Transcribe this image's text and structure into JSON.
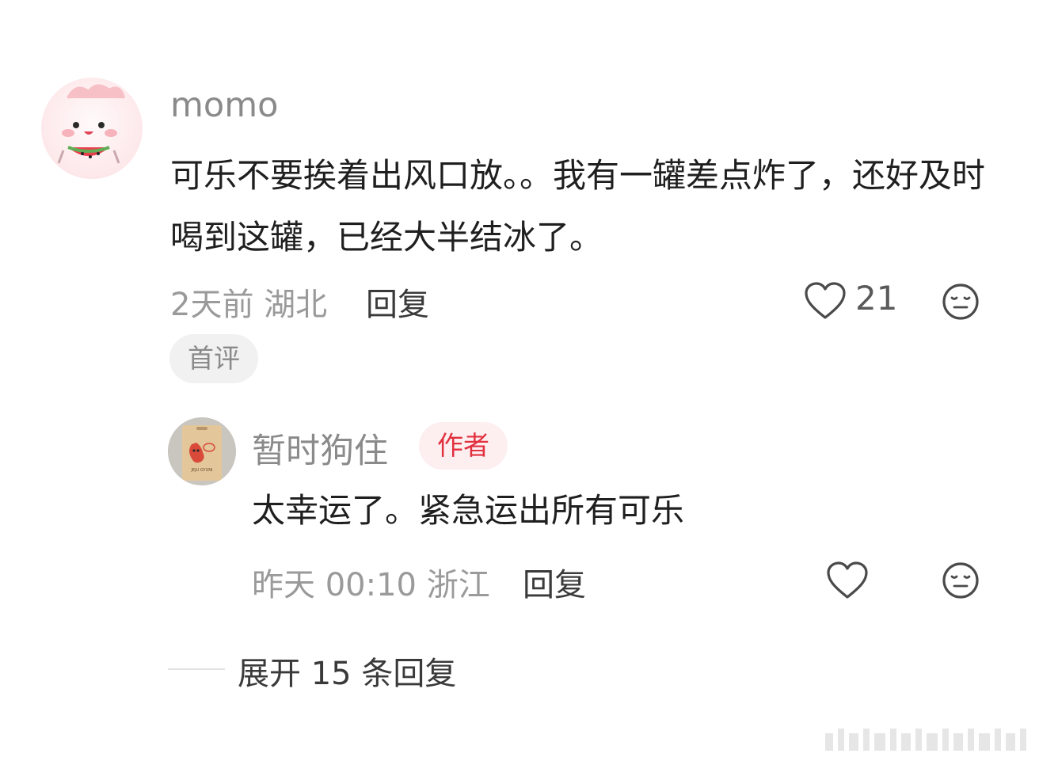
{
  "comment": {
    "username": "momo",
    "text": "可乐不要挨着出风口放。。我有一罐差点炸了，还好及时喝到这罐，已经大半结冰了。",
    "meta": "2天前 湖北",
    "reply_label": "回复",
    "likes": "21",
    "badge": "首评",
    "like_icon": "heart-outline-icon",
    "dislike_icon": "meh-face-icon"
  },
  "reply": {
    "username": "暂时狗住",
    "author_badge": "作者",
    "text": "太幸运了。紧急运出所有可乐",
    "meta": "昨天 00:10 浙江",
    "reply_label": "回复",
    "avatar_text": "JEJU GYUNI"
  },
  "expand": {
    "label": "展开 15 条回复"
  },
  "colors": {
    "author_badge_text": "#e1303e",
    "author_badge_bg": "#fdeef0",
    "badge_bg": "#f1f1f1",
    "muted_text": "#9a9a9a"
  }
}
